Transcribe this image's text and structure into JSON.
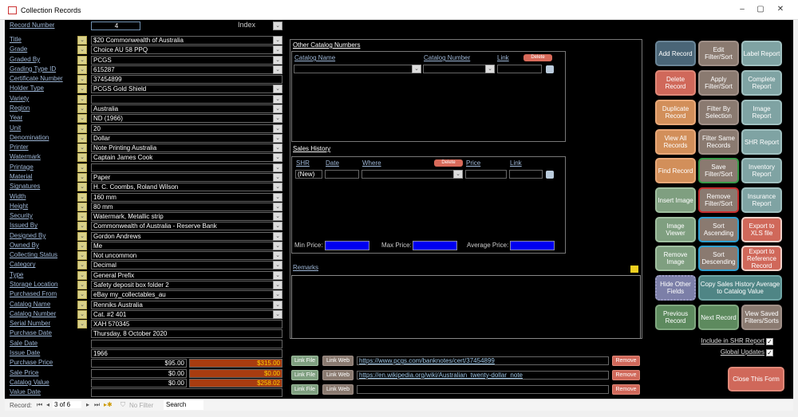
{
  "window": {
    "title": "Collection Records",
    "controls": [
      "–",
      "▢",
      "✕"
    ]
  },
  "record_number": {
    "label": "Record Number",
    "value": "4",
    "index_label": "Index"
  },
  "fields": [
    {
      "label": "Title",
      "value": "$20 Commonwealth of Australia",
      "picker": true,
      "combo": true
    },
    {
      "label": "Grade",
      "value": "Choice AU 58 PPQ",
      "picker": true,
      "combo": true
    },
    {
      "label": "Graded By",
      "value": "PCGS",
      "picker": true,
      "combo": true
    },
    {
      "label": "Grading Type ID",
      "value": "615287",
      "picker": true,
      "combo": true
    },
    {
      "label": "Certificate Number",
      "value": "37454899",
      "picker": true,
      "combo": false
    },
    {
      "label": "Holder Type",
      "value": "PCGS Gold Shield",
      "picker": true,
      "combo": true
    },
    {
      "label": "Variety",
      "value": "",
      "picker": true,
      "combo": true
    },
    {
      "label": "Region",
      "value": "Australia",
      "picker": true,
      "combo": true
    },
    {
      "label": "Year",
      "value": "ND (1966)",
      "picker": true,
      "combo": true
    },
    {
      "label": "Unit",
      "value": "20",
      "picker": true,
      "combo": true
    },
    {
      "label": "Denomination",
      "value": "Dollar",
      "picker": true,
      "combo": true
    },
    {
      "label": "Printer",
      "value": "Note Printing Australia",
      "picker": true,
      "combo": true
    },
    {
      "label": "Watermark",
      "value": "Captain James Cook",
      "picker": true,
      "combo": true
    },
    {
      "label": "Printage",
      "value": "",
      "picker": true,
      "combo": true
    },
    {
      "label": "Material",
      "value": "Paper",
      "picker": true,
      "combo": true
    },
    {
      "label": "Signatures",
      "value": "H. C. Coombs, Roland Wilson",
      "picker": true,
      "combo": true
    },
    {
      "label": "Width",
      "value": "160 mm",
      "picker": true,
      "combo": true
    },
    {
      "label": "Height",
      "value": "80 mm",
      "picker": true,
      "combo": true
    },
    {
      "label": "Security",
      "value": "Watermark, Metallic strip",
      "picker": true,
      "combo": true
    },
    {
      "label": "Issued By",
      "value": "Commonwealth of Australia - Reserve Bank",
      "picker": true,
      "combo": true
    },
    {
      "label": "Designed By",
      "value": "Gordon Andrews",
      "picker": true,
      "combo": true
    },
    {
      "label": "Owned By",
      "value": "Me",
      "picker": true,
      "combo": true
    },
    {
      "label": "Collecting Status",
      "value": "Not uncommon",
      "picker": true,
      "combo": true
    },
    {
      "label": "Category",
      "value": "Decimal",
      "picker": true,
      "combo": true
    },
    {
      "label": "Type",
      "value": "General Prefix",
      "picker": true,
      "combo": true
    },
    {
      "label": "Storage Location",
      "value": "Safety deposit box folder 2",
      "picker": true,
      "combo": true
    },
    {
      "label": "Purchased From",
      "value": "eBay my_collectables_au",
      "picker": true,
      "combo": true
    },
    {
      "label": "Catalog Name",
      "value": "Renniks Australia",
      "picker": true,
      "combo": true
    },
    {
      "label": "Catalog Number",
      "value": "Cat. #2 401",
      "picker": true,
      "combo": true
    },
    {
      "label": "Serial Number",
      "value": "XAH 570345",
      "picker": true,
      "combo": false
    },
    {
      "label": "Purchase Date",
      "value": "Thursday, 8 October 2020",
      "picker": false,
      "combo": false
    },
    {
      "label": "Sale Date",
      "value": "",
      "picker": false,
      "combo": false
    },
    {
      "label": "Issue Date",
      "value": "1966",
      "picker": false,
      "combo": false
    },
    {
      "label": "Purchase Price",
      "value": "$95.00",
      "value2": "$315.00",
      "picker": false,
      "combo": false
    },
    {
      "label": "Sale Price",
      "value": "$0.00",
      "value2": "$0.00",
      "picker": false,
      "combo": false
    },
    {
      "label": "Catalog Value",
      "value": "$0.00",
      "value2": "$258.02",
      "picker": false,
      "combo": false
    },
    {
      "label": "Value Date",
      "value": "",
      "picker": false,
      "combo": false
    }
  ],
  "other_catalog": {
    "title": "Other Catalog Numbers",
    "col_name": "Catalog Name",
    "col_number": "Catalog Number",
    "col_link": "Link",
    "delete": "Delete"
  },
  "sales_history": {
    "title": "Sales History",
    "col_shr": "SHR",
    "col_date": "Date",
    "col_where": "Where",
    "col_price": "Price",
    "col_link": "Link",
    "delete": "Delete",
    "new_row": "(New)",
    "min_label": "Min Price:",
    "max_label": "Max Price:",
    "avg_label": "Average Price:"
  },
  "remarks": {
    "label": "Remarks",
    "value": ""
  },
  "links": [
    {
      "file": "Link File",
      "web": "Link Web",
      "url": "https://www.pcgs.com/banknotes/cert/37454899",
      "remove": "Remove"
    },
    {
      "file": "Link File",
      "web": "Link Web",
      "url": "https://en.wikipedia.org/wiki/Australian_twenty-dollar_note",
      "remove": "Remove"
    },
    {
      "file": "Link File",
      "web": "Link Web",
      "url": "",
      "remove": "Remove"
    }
  ],
  "buttons": [
    {
      "label": "Add Record",
      "color": "#4a6577",
      "border": "#6a8597"
    },
    {
      "label": "Edit Filter/Sort",
      "color": "#8a7a70",
      "border": "#a09088"
    },
    {
      "label": "Label Report",
      "color": "#7fa3a3",
      "border": "#a0c0c0"
    },
    {
      "label": "Delete Record",
      "color": "#d0685a",
      "border": "#e08878"
    },
    {
      "label": "Apply Filter/Sort",
      "color": "#8a7a70",
      "border": "#a09088"
    },
    {
      "label": "Complete Report",
      "color": "#7fa3a3",
      "border": "#a0c0c0"
    },
    {
      "label": "Duplicate Record",
      "color": "#d28f5a",
      "border": "#e8a878"
    },
    {
      "label": "Filter By Selection",
      "color": "#8a7a70",
      "border": "#a09088"
    },
    {
      "label": "Image Report",
      "color": "#7fa3a3",
      "border": "#a0c0c0"
    },
    {
      "label": "View All Records",
      "color": "#d28f5a",
      "border": "#e8a878"
    },
    {
      "label": "Filter Same Records",
      "color": "#8a7a70",
      "border": "#a09088"
    },
    {
      "label": "SHR Report",
      "color": "#7fa3a3",
      "border": "#a0c0c0"
    },
    {
      "label": "Find Record",
      "color": "#d28f5a",
      "border": "#e8a878"
    },
    {
      "label": "Save Filter/Sort",
      "color": "#8a7a70",
      "border": "#3a9a4a"
    },
    {
      "label": "Inventory Report",
      "color": "#7fa3a3",
      "border": "#a0c0c0"
    },
    {
      "label": "Insert Image",
      "color": "#7f9f80",
      "border": "#a0c0a0"
    },
    {
      "label": "Remove Filter/Sort",
      "color": "#8a7a70",
      "border": "#c83030"
    },
    {
      "label": "Insurance Report",
      "color": "#7fa3a3",
      "border": "#a0c0c0"
    },
    {
      "label": "Image Viewer",
      "color": "#7f9f80",
      "border": "#a0c0a0"
    },
    {
      "label": "Sort Ascending",
      "color": "#8a7a70",
      "border": "#30a0d0"
    },
    {
      "label": "Export to XLS file",
      "color": "#d0685a",
      "border": "#f0d0c8"
    },
    {
      "label": "Remove Image",
      "color": "#7f9f80",
      "border": "#a0c0a0"
    },
    {
      "label": "Sort Descending",
      "color": "#8a7a70",
      "border": "#30a0d0"
    },
    {
      "label": "Export to Reference Record",
      "color": "#d0685a",
      "border": "#f0d0c8"
    },
    {
      "label": "Hide Other Fields",
      "color": "#7c7fa8",
      "border": "#a0a0c8"
    },
    {
      "label": "Copy Sales History Average to Catalog Value",
      "color": "#4f8585",
      "border": "#6fa5a5"
    },
    {
      "label": "Previous Record",
      "color": "#5d8a5e",
      "border": "#80a880"
    },
    {
      "label": "Next Record",
      "color": "#5d8a5e",
      "border": "#80a880"
    },
    {
      "label": "View Saved Filters/Sorts",
      "color": "#8a7a70",
      "border": "#a09088"
    }
  ],
  "checkboxes": [
    {
      "label": "Include in SHR Report",
      "checked": true
    },
    {
      "label": "Global Updates",
      "checked": true
    }
  ],
  "close_button": "Close This Form",
  "statusbar": {
    "record_label": "Record:",
    "position": "3 of 6",
    "filter": "No Filter",
    "search": "Search"
  }
}
